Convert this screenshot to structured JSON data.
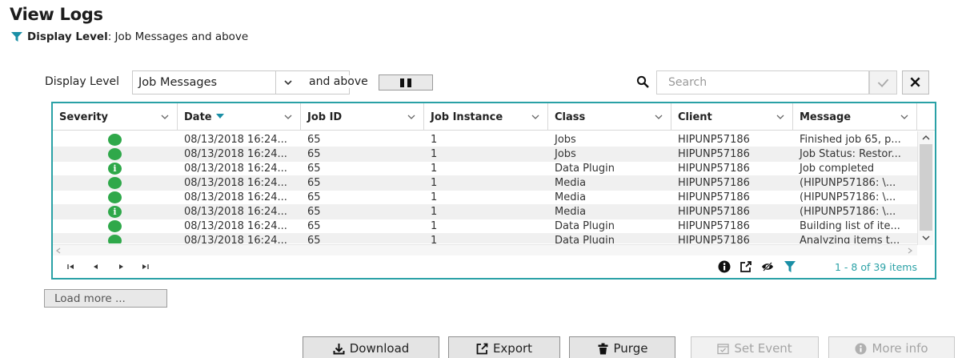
{
  "header": {
    "title": "View Logs",
    "cursor": "I",
    "display_level_label": "Display Level",
    "display_level_value": ": Job Messages and above"
  },
  "toolbar": {
    "display_level_label": "Display Level",
    "display_level_selected": "Job Messages",
    "and_above": "and above",
    "search_placeholder": "Search"
  },
  "grid": {
    "columns": [
      "Severity",
      "Date",
      "Job ID",
      "Job Instance",
      "Class",
      "Client",
      "Message"
    ],
    "sort_column": "Date",
    "rows": [
      {
        "severity": "success",
        "date": "08/13/2018 16:24...",
        "job_id": "65",
        "instance": "1",
        "class": "Jobs",
        "client": "HIPUNP57186",
        "message": "Finished job 65, p..."
      },
      {
        "severity": "success",
        "date": "08/13/2018 16:24...",
        "job_id": "65",
        "instance": "1",
        "class": "Jobs",
        "client": "HIPUNP57186",
        "message": "Job Status: Restor..."
      },
      {
        "severity": "info",
        "date": "08/13/2018 16:24...",
        "job_id": "65",
        "instance": "1",
        "class": "Data Plugin",
        "client": "HIPUNP57186",
        "message": "Job completed"
      },
      {
        "severity": "success",
        "date": "08/13/2018 16:24...",
        "job_id": "65",
        "instance": "1",
        "class": "Media",
        "client": "HIPUNP57186",
        "message": "(HIPUNP57186: \\..."
      },
      {
        "severity": "success",
        "date": "08/13/2018 16:24...",
        "job_id": "65",
        "instance": "1",
        "class": "Media",
        "client": "HIPUNP57186",
        "message": "(HIPUNP57186: \\..."
      },
      {
        "severity": "info",
        "date": "08/13/2018 16:24...",
        "job_id": "65",
        "instance": "1",
        "class": "Media",
        "client": "HIPUNP57186",
        "message": "(HIPUNP57186: \\..."
      },
      {
        "severity": "success",
        "date": "08/13/2018 16:24...",
        "job_id": "65",
        "instance": "1",
        "class": "Data Plugin",
        "client": "HIPUNP57186",
        "message": "Building list of ite..."
      },
      {
        "severity": "success",
        "date": "08/13/2018 16:24...",
        "job_id": "65",
        "instance": "1",
        "class": "Data Plugin",
        "client": "HIPUNP57186",
        "message": "Analyzing items t..."
      }
    ],
    "info_glyph": "i",
    "page_count": "1 - 8 of 39 items",
    "icons": [
      "info-icon",
      "export-icon",
      "hide-columns-icon",
      "filter-icon"
    ]
  },
  "load_more": "Load more ...",
  "actions": [
    {
      "label": "Download",
      "icon": "download-icon",
      "enabled": true
    },
    {
      "label": "Export",
      "icon": "export-icon",
      "enabled": true
    },
    {
      "label": "Purge",
      "icon": "trash-icon",
      "enabled": true
    },
    {
      "label": "Set Event",
      "icon": "event-icon",
      "enabled": false
    },
    {
      "label": "More info",
      "icon": "info-icon",
      "enabled": false
    }
  ],
  "colors": {
    "accent": "#2aa1a6",
    "severity_ok": "#2fa84a",
    "filter": "#1a8fa6"
  }
}
